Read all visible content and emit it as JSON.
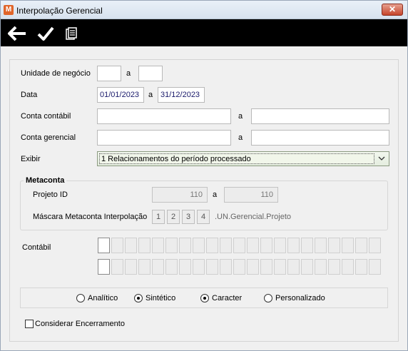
{
  "window": {
    "title": "Interpolação Gerencial",
    "close_glyph": "✕",
    "app_icon_glyph": "M"
  },
  "toolbar": {
    "back_icon": "arrow-left",
    "confirm_icon": "checkmark",
    "copy_icon": "documents"
  },
  "form": {
    "unidade_label": "Unidade de negócio",
    "a_label": "a",
    "data_label": "Data",
    "data_from": "01/01/2023",
    "data_to": "31/12/2023",
    "conta_contabil_label": "Conta contábil",
    "conta_gerencial_label": "Conta gerencial",
    "exibir_label": "Exibir",
    "exibir_value": "1 Relacionamentos do período processado"
  },
  "metaconta": {
    "title": "Metaconta",
    "projeto_label": "Projeto ID",
    "projeto_from": "110",
    "projeto_to": "110",
    "mascara_label": "Máscara Metaconta Interpolação",
    "segments": [
      "1",
      "2",
      "3",
      "4"
    ],
    "mascara_suffix": ".UN.Gerencial.Projeto"
  },
  "contabil_label": "Contábil",
  "options": {
    "analitico": "Analítico",
    "sintetico": "Sintético",
    "caracter": "Caracter",
    "personalizado": "Personalizado",
    "selected": [
      "sintetico",
      "caracter"
    ]
  },
  "considerar_label": "Considerar Encerramento"
}
